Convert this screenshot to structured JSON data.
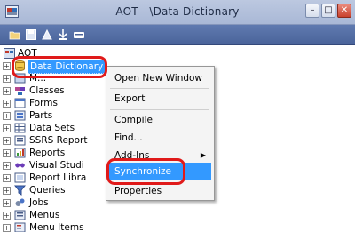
{
  "window": {
    "title": "AOT - \\Data Dictionary"
  },
  "title_buttons": {
    "minimize": "–",
    "maximize": "□",
    "close": "✕"
  },
  "tree": {
    "root": "AOT",
    "items": [
      {
        "label": "Data Dictionary",
        "icon": "folder-db-icon",
        "selected": true
      },
      {
        "label": "M...",
        "icon": "macro-icon"
      },
      {
        "label": "Classes",
        "icon": "class-icon"
      },
      {
        "label": "Forms",
        "icon": "form-icon"
      },
      {
        "label": "Parts",
        "icon": "part-icon"
      },
      {
        "label": "Data Sets",
        "icon": "dataset-icon"
      },
      {
        "label": "SSRS Report",
        "icon": "ssrs-report-icon"
      },
      {
        "label": "Reports",
        "icon": "report-icon"
      },
      {
        "label": "Visual Studi",
        "icon": "visual-studio-icon"
      },
      {
        "label": "Report Libra",
        "icon": "report-library-icon"
      },
      {
        "label": "Queries",
        "icon": "query-icon"
      },
      {
        "label": "Jobs",
        "icon": "job-icon"
      },
      {
        "label": "Menus",
        "icon": "menu-icon"
      },
      {
        "label": "Menu Items",
        "icon": "menu-items-icon"
      }
    ]
  },
  "context_menu": {
    "items": [
      "Open New Window",
      "Export",
      "Compile",
      "Find...",
      "Add-Ins",
      "Synchronize",
      "Properties"
    ],
    "highlighted": "Synchronize",
    "submenu_arrow": "▶"
  },
  "colors": {
    "selection": "#3399ff",
    "annotation": "#e01a1a"
  }
}
